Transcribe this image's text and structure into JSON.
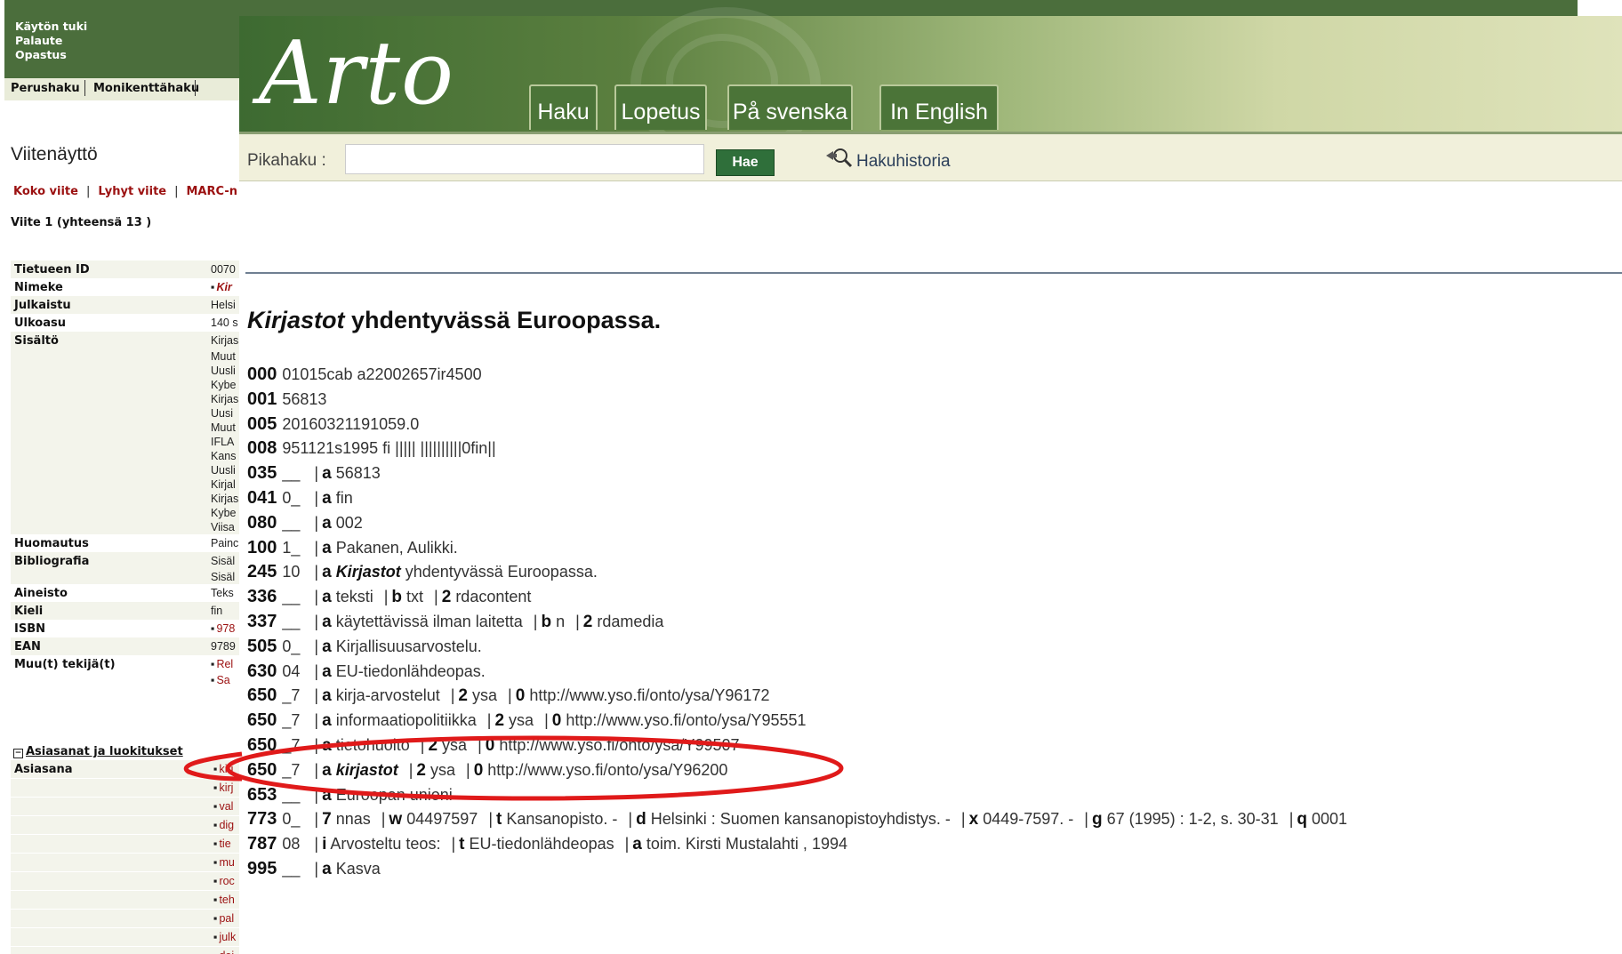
{
  "left": {
    "help_links": [
      "Käytön tuki",
      "Palaute",
      "Opastus"
    ],
    "search_tabs": [
      "Perushaku",
      "Monikenttähaku"
    ],
    "page_title": "Viitenäyttö",
    "view_links": [
      "Koko viite",
      "Lyhyt viite",
      "MARC-n"
    ],
    "record_count": "Viite 1 (yhteensä 13 )",
    "fields": [
      {
        "label": "Tietueen ID",
        "values": [
          "0070"
        ]
      },
      {
        "label": "Nimeke",
        "values": [
          "Kir"
        ],
        "style": "red-bullet"
      },
      {
        "label": "Julkaistu",
        "values": [
          "Helsi"
        ]
      },
      {
        "label": "Ulkoasu",
        "values": [
          "140 s"
        ]
      },
      {
        "label": "Sisältö",
        "values": [
          "Kirjas",
          "Muut",
          "Uusli",
          "Kybe",
          "Kirjas",
          "Uusi",
          "Muut",
          "IFLA",
          "Kans",
          "Uusli",
          "Kirjal",
          "Kirjas",
          "Kybe",
          "Viisa"
        ]
      },
      {
        "label": "Huomautus",
        "values": [
          "Painc"
        ]
      },
      {
        "label": "Bibliografia",
        "values": [
          "Sisäl",
          "Sisäl"
        ]
      },
      {
        "label": "Aineisto",
        "values": [
          "Teks"
        ]
      },
      {
        "label": "Kieli",
        "values": [
          "fin"
        ]
      },
      {
        "label": "ISBN",
        "values": [
          "978"
        ],
        "style": "red-bullet"
      },
      {
        "label": "EAN",
        "values": [
          "9789"
        ]
      },
      {
        "label": "Muu(t) tekijä(t)",
        "values": [
          "Rel",
          "Sa"
        ],
        "style": "red-bullet"
      }
    ],
    "subjects_heading": "Asiasanat ja luokitukset",
    "subjects_label": "Asiasana",
    "subjects": [
      "kirj",
      "kirj",
      "val",
      "dig",
      "tie",
      "mu",
      "roc",
      "teh",
      "pal",
      "julk",
      "dei"
    ]
  },
  "arto": {
    "logo": "Arto",
    "tabs": [
      "Haku",
      "Lopetus",
      "På svenska",
      "In English"
    ],
    "search_label": "Pikahaku :",
    "search_value": "",
    "search_button": "Hae",
    "history_link": "Hakuhistoria"
  },
  "record": {
    "title_italic": "Kirjastot",
    "title_rest": " yhdentyvässä Euroopassa.",
    "marc": [
      {
        "tag": "000",
        "text": "01015cab a22002657ir4500"
      },
      {
        "tag": "001",
        "text": "56813"
      },
      {
        "tag": "005",
        "text": "20160321191059.0"
      },
      {
        "tag": "008",
        "text": "951121s1995 fi ||||| ||||||||||0fin||"
      },
      {
        "tag": "035",
        "ind": "__",
        "subfields": [
          {
            "c": "a",
            "v": "56813"
          }
        ]
      },
      {
        "tag": "041",
        "ind": "0_",
        "subfields": [
          {
            "c": "a",
            "v": "fin"
          }
        ]
      },
      {
        "tag": "080",
        "ind": "__",
        "subfields": [
          {
            "c": "a",
            "v": "002"
          }
        ]
      },
      {
        "tag": "100",
        "ind": "1_",
        "subfields": [
          {
            "c": "a",
            "v": "Pakanen, Aulikki."
          }
        ]
      },
      {
        "tag": "245",
        "ind": "10",
        "subfields": [
          {
            "c": "a",
            "v": "Kirjastot",
            "italic": true,
            "after": " yhdentyvässä Euroopassa."
          }
        ]
      },
      {
        "tag": "336",
        "ind": "__",
        "subfields": [
          {
            "c": "a",
            "v": "teksti"
          },
          {
            "c": "b",
            "v": "txt"
          },
          {
            "c": "2",
            "v": "rdacontent"
          }
        ]
      },
      {
        "tag": "337",
        "ind": "__",
        "subfields": [
          {
            "c": "a",
            "v": "käytettävissä ilman laitetta"
          },
          {
            "c": "b",
            "v": "n"
          },
          {
            "c": "2",
            "v": "rdamedia"
          }
        ]
      },
      {
        "tag": "505",
        "ind": "0_",
        "subfields": [
          {
            "c": "a",
            "v": "Kirjallisuusarvostelu."
          }
        ]
      },
      {
        "tag": "630",
        "ind": "04",
        "subfields": [
          {
            "c": "a",
            "v": "EU-tiedonlähdeopas."
          }
        ]
      },
      {
        "tag": "650",
        "ind": "_7",
        "subfields": [
          {
            "c": "a",
            "v": "kirja-arvostelut"
          },
          {
            "c": "2",
            "v": "ysa"
          },
          {
            "c": "0",
            "v": "http://www.yso.fi/onto/ysa/Y96172"
          }
        ]
      },
      {
        "tag": "650",
        "ind": "_7",
        "subfields": [
          {
            "c": "a",
            "v": "informaatiopolitiikka"
          },
          {
            "c": "2",
            "v": "ysa"
          },
          {
            "c": "0",
            "v": "http://www.yso.fi/onto/ysa/Y95551"
          }
        ]
      },
      {
        "tag": "650",
        "ind": "_7",
        "subfields": [
          {
            "c": "a",
            "v": "tietohuolto"
          },
          {
            "c": "2",
            "v": "ysa"
          },
          {
            "c": "0",
            "v": "http://www.yso.fi/onto/ysa/Y99507"
          }
        ]
      },
      {
        "tag": "650",
        "ind": "_7",
        "subfields": [
          {
            "c": "a",
            "v": "kirjastot",
            "italic": true
          },
          {
            "c": "2",
            "v": "ysa"
          },
          {
            "c": "0",
            "v": "http://www.yso.fi/onto/ysa/Y96200"
          }
        ]
      },
      {
        "tag": "653",
        "ind": "__",
        "subfields": [
          {
            "c": "a",
            "v": "Euroopan unioni"
          }
        ]
      },
      {
        "tag": "773",
        "ind": "0_",
        "subfields": [
          {
            "c": "7",
            "v": "nnas"
          },
          {
            "c": "w",
            "v": "04497597"
          },
          {
            "c": "t",
            "v": "Kansanopisto. -"
          },
          {
            "c": "d",
            "v": "Helsinki : Suomen kansanopistoyhdistys. -"
          },
          {
            "c": "x",
            "v": "0449-7597. -"
          },
          {
            "c": "g",
            "v": "67 (1995) : 1-2, s. 30-31"
          },
          {
            "c": "q",
            "v": "0001"
          }
        ]
      },
      {
        "tag": "787",
        "ind": "08",
        "subfields": [
          {
            "c": "i",
            "v": "Arvosteltu teos:"
          },
          {
            "c": "t",
            "v": "EU-tiedonlähdeopas"
          },
          {
            "c": "a",
            "v": "toim. Kirsti Mustalahti , 1994"
          }
        ]
      },
      {
        "tag": "995",
        "ind": "__",
        "subfields": [
          {
            "c": "a",
            "v": "Kasva"
          }
        ]
      }
    ]
  },
  "annotation": {
    "color": "#e01a1a",
    "highlighted_line": "650 _7 |a kirjastot"
  }
}
